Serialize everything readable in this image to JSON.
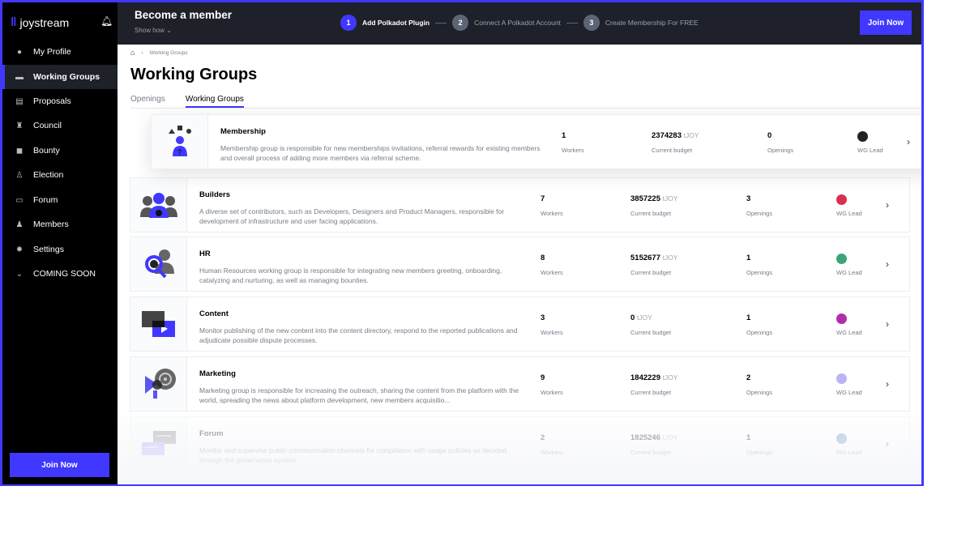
{
  "app": {
    "logo": "joystream"
  },
  "sidebar": {
    "items": [
      {
        "label": "My Profile",
        "icon": "user-icon",
        "glyph": "●"
      },
      {
        "label": "Working Groups",
        "icon": "briefcase-icon",
        "glyph": "▬",
        "active": true
      },
      {
        "label": "Proposals",
        "icon": "document-icon",
        "glyph": "▤"
      },
      {
        "label": "Council",
        "icon": "council-icon",
        "glyph": "♜"
      },
      {
        "label": "Bounty",
        "icon": "bounty-icon",
        "glyph": "◼"
      },
      {
        "label": "Election",
        "icon": "ballot-icon",
        "glyph": "♙"
      },
      {
        "label": "Forum",
        "icon": "chat-icon",
        "glyph": "▭"
      },
      {
        "label": "Members",
        "icon": "members-icon",
        "glyph": "♟"
      },
      {
        "label": "Settings",
        "icon": "gear-icon",
        "glyph": "✹"
      },
      {
        "label": "COMING SOON",
        "icon": "chevron-down-icon",
        "glyph": "⌄"
      }
    ],
    "join_label": "Join Now"
  },
  "header": {
    "title": "Become a member",
    "show_how": "Show how ⌄",
    "steps": [
      {
        "num": "1",
        "label": "Add Polkadot Plugin"
      },
      {
        "num": "2",
        "label": "Connect A Polkadot Account"
      },
      {
        "num": "3",
        "label": "Create Membership For FREE"
      }
    ],
    "join_label": "Join Now"
  },
  "breadcrumb": {
    "current": "Working Groups"
  },
  "page": {
    "title": "Working Groups",
    "tabs": [
      "Openings",
      "Working Groups"
    ]
  },
  "labels": {
    "workers": "Workers",
    "budget": "Current budget",
    "openings": "Openings",
    "lead": "WG Lead",
    "unit": "tJOY"
  },
  "groups": [
    {
      "name": "Membership",
      "desc": "Membership group is responsible for new memberships invitations, referral rewards for existing members and overall process of adding more members via referral scheme.",
      "workers": "1",
      "budget": "2374283",
      "openings": "0",
      "lead_color": "#222222"
    },
    {
      "name": "Builders",
      "desc": "A diverse set of contributors, such as Developers, Designers and Product Managers, responsible for development of infrastructure and user facing applications.",
      "workers": "7",
      "budget": "3857225",
      "openings": "3",
      "lead_color": "#d9304f"
    },
    {
      "name": "HR",
      "desc": "Human Resources working group is responsible for integrating new members greeting, onboarding, catalyzing and nurturing, as well as managing bounties.",
      "workers": "8",
      "budget": "5152677",
      "openings": "1",
      "lead_color": "#3fa37a"
    },
    {
      "name": "Content",
      "desc": "Monitor publishing of the new content into the content directory, respond to the reported publications and adjudicate possible dispute processes.",
      "workers": "3",
      "budget": "0",
      "openings": "1",
      "lead_color": "#b02fa8"
    },
    {
      "name": "Marketing",
      "desc": "Marketing group is responsible for increasing the outreach, sharing the content from the platform with the world, spreading the news about platform development, new members acquisitio...",
      "workers": "9",
      "budget": "1842229",
      "openings": "2",
      "lead_color": "#b9b4f5"
    },
    {
      "name": "Forum",
      "desc": "Monitor and supervise public communication channels for compliance with usage policies as decided through the governance system.",
      "workers": "2",
      "budget": "1825246",
      "openings": "1",
      "lead_color": "#5a8fc4"
    }
  ],
  "colors": {
    "accent": "#4038ff",
    "sidebar": "#000000",
    "header": "#1e2129"
  }
}
